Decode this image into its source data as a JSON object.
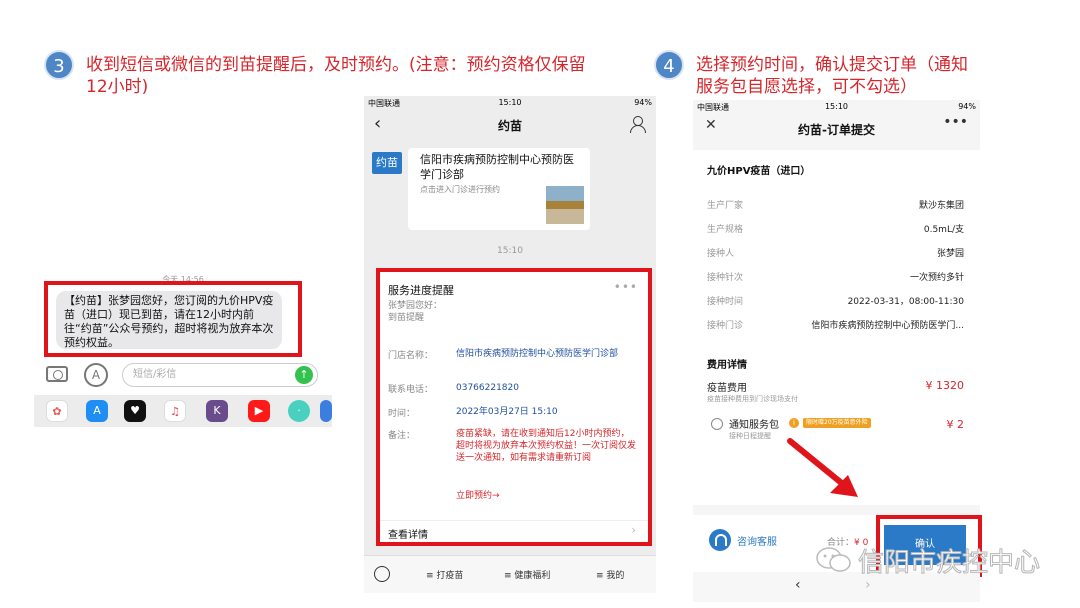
{
  "step3": {
    "number": "3",
    "text_line1": "收到短信或微信的到苗提醒后，及时预约。(注意：预约资格仅保留",
    "text_line2": "12小时)"
  },
  "step4": {
    "number": "4",
    "text_line1": "选择预约时间，确认提交订单（通知",
    "text_line2": "服务包自愿选择，可不勾选）"
  },
  "sms": {
    "time": "今天 14:56",
    "message": "【约苗】张梦园您好，您订阅的九价HPV疫苗（进口）现已到苗，请在12小时内前往“约苗”公众号预约，超时将视为放弃本次预约权益。",
    "input_placeholder": "短信/彩信",
    "send_icon": "↑"
  },
  "phone1": {
    "status": {
      "carrier": "中国联通",
      "time": "15:10",
      "battery": "94%"
    },
    "title": "约苗",
    "avatar_label": "约苗",
    "card_title": "信阳市疾病预防控制中心预防医学门诊部",
    "card_sub": "点击进入门诊进行预约",
    "timestamp": "15:10",
    "service": {
      "header": "服务进度提醒",
      "greeting": "张梦园您好：",
      "greeting2": "到苗提醒",
      "store_label": "门店名称：",
      "store_value": "信阳市疾病预防控制中心预防医学门诊部",
      "phone_label": "联系电话：",
      "phone_value": "03766221820",
      "time_label": "时间：",
      "time_value": "2022年03月27日 15:10",
      "remark_label": "备注：",
      "remark_value": "疫苗紧缺，请在收到通知后12小时内预约，超时将视为放弃本次预约权益！一次订阅仅发送一次通知，如有需求请重新订阅",
      "link": "立即预约→",
      "detail": "查看详情"
    },
    "tabs": [
      "打疫苗",
      "健康福利",
      "我的"
    ]
  },
  "phone2": {
    "status": {
      "carrier": "中国联通",
      "time": "15:10",
      "battery": "94%"
    },
    "title": "约苗-订单提交",
    "vaccine": "九价HPV疫苗（进口）",
    "rows": [
      {
        "k": "生产厂家",
        "v": "默沙东集团"
      },
      {
        "k": "生产规格",
        "v": "0.5mL/支"
      },
      {
        "k": "接种人",
        "v": "张梦园"
      },
      {
        "k": "接种针次",
        "v": "一次预约多针"
      },
      {
        "k": "接种时间",
        "v": "2022-03-31，08:00-11:30"
      },
      {
        "k": "接种门诊",
        "v": "信阳市疾病预防控制中心预防医学门..."
      }
    ],
    "fee_title": "费用详情",
    "vaccine_fee": "疫苗费用",
    "vaccine_fee_sub": "疫苗接种费用到门诊现场支付",
    "vaccine_fee_price": "¥ 1320",
    "notify": "通知服务包",
    "notify_tag": "限时赠20万疫苗意外险",
    "notify_sub": "接种日程提醒",
    "notify_price": "¥ 2",
    "customer_service": "咨询客服",
    "total_label": "合计：",
    "total_value": "¥ 0",
    "confirm": "确认"
  },
  "watermark": "信阳市疾控中心",
  "colors": {
    "accent_red": "#e0151b",
    "blue": "#2b7ac8"
  }
}
